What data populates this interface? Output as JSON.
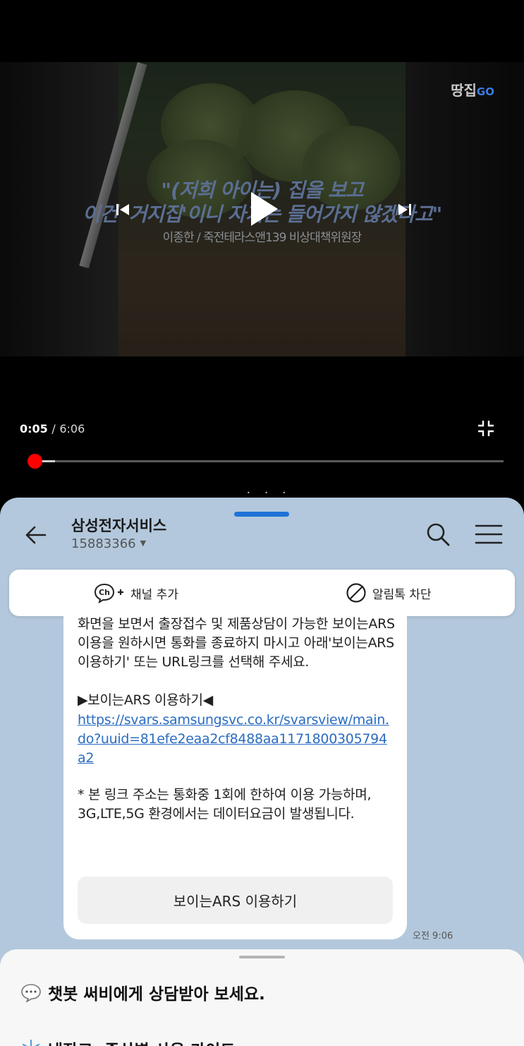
{
  "video": {
    "channel_logo": "땅집",
    "channel_logo_suffix": "GO",
    "caption_line1": "\"(저희 아이는) 집을 보고",
    "caption_line2": "이건 '거지집'이니 자기는 들어가지 않겠다고\"",
    "caption_speaker": "이종한 / 죽전테라스앤139 비상대책위원장",
    "current_time": "0:05",
    "separator": "/",
    "duration": "6:06",
    "progress_fraction": 0.0137,
    "icons": {
      "play": "play-icon",
      "previous": "previous-track-icon",
      "next": "next-track-icon",
      "exit_fullscreen": "exit-fullscreen-icon"
    },
    "accent_color": "#ff0000"
  },
  "split_handle": "• • •",
  "chat": {
    "title": "삼성전자서비스",
    "subtitle": "15883366",
    "add_channel_label": "채널 추가",
    "block_label": "알림톡 차단",
    "message": {
      "intro": "화면을 보면서 출장접수 및 제품상담이 가능한 보이는ARS 이용을 원하시면 통화를 종료하지 마시고 아래'보이는ARS 이용하기' 또는 URL링크를 선택해 주세요.",
      "arrow_label": "▶보이는ARS 이용하기◀",
      "link": "https://svars.samsungsvc.co.kr/svarsview/main.do?uuid=81efe2eaa2cf8488aa1171800305794a2",
      "note": "* 본 링크 주소는 통화중 1회에 한하여 이용 가능하며, 3G,LTE,5G 환경에서는 데이터요금이 발생됩니다.",
      "button_label": "보이는ARS 이용하기"
    },
    "timestamp": "오전 9:06",
    "bottom_sheet": {
      "item1": "챗봇 써비에게 상담받아 보세요.",
      "item2": "냉장고, 증상별 사용 가이드"
    },
    "colors": {
      "background": "#b3c8dc",
      "handle": "#1e73d8",
      "link": "#2a6cc1"
    }
  }
}
